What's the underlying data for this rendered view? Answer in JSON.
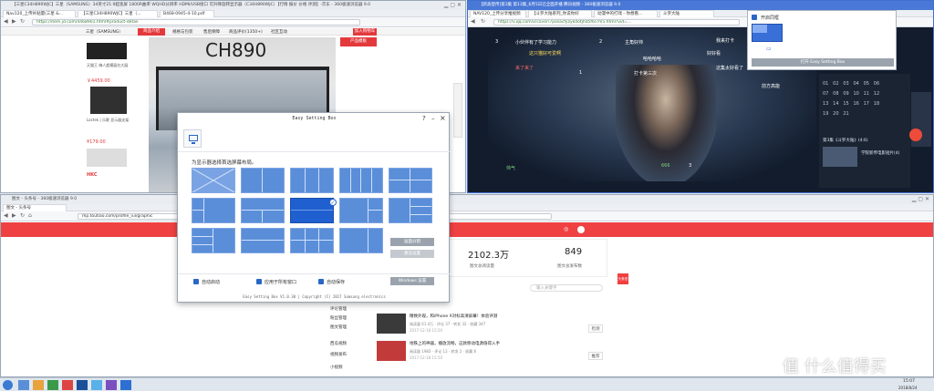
{
  "jd_window": {
    "title": "【三星C34H890WJC】三星（SAMSUNG）34英寸21:9超宽屏 1800R曲率 WQHD分辨率 HDMI/USB接口 可升降旋转显示器（C34H890WJC）【行情 报价 价格 评测】-京东 - 360极速浏览器 9.0",
    "url": "https://item.jd.com/4468901.html#product-detail",
    "tab1": "Nav120_上传补贴量(三星 &...",
    "tab2": "【三星C34H890WJC】三星（...",
    "tab3": "B468-0945-4-10.pdf",
    "nav_left": "三星（SAMSUNG）",
    "nav_tabs": [
      "商品介绍",
      "规格与包装",
      "售后保障",
      "商品评价(1350+)",
      "社区互动"
    ],
    "product_heading": "CH890",
    "cart": "加入购物车",
    "reco_label": "产品模板",
    "side": [
      "天猫王 嗨人超模展台大展",
      "￥4459.00",
      "¥459.00",
      "Loctek | 乐歌 显示器支架",
      "¥179.00",
      "HKC"
    ]
  },
  "qq_window": {
    "title": "【新高登传]第3集 第13集_6月5日已全面开播 腾讯视频 - 360极速浏览器 9.0",
    "url": "https://v.qq.com/x/cover/7pseacfyzykdotjhd5f6l7m5.html?vid=...",
    "tabs": [
      "NAV120_上传分享推视频",
      "【斗罗大陆系列_你说你好",
      "动漫中的打戏 - 你想看...",
      "斗罗大陆"
    ],
    "danmaku": [
      "小伙伴有了学习能力",
      "这只猫好可爱啊",
      "我来打卡",
      "好好看",
      "主角好帅",
      "哈哈哈哈",
      "来了来了",
      "打卡第三次",
      "这集太好看了",
      "前方高能",
      "帅气",
      "666"
    ],
    "likes": [
      "3",
      "2",
      "1",
      "3"
    ],
    "numbers": [
      "01",
      "02",
      "03",
      "04",
      "05",
      "06",
      "07",
      "08",
      "09",
      "10",
      "11",
      "12",
      "13",
      "14",
      "15",
      "16",
      "17",
      "18",
      "19",
      "20",
      "21"
    ],
    "side_texts": [
      "第3集《斗罗大陆》(4:6)",
      "学院新传电影短片(4)"
    ],
    "popup_title": "开启同框",
    "popup_btn": "打开 Easy Setting Box"
  },
  "tt_window": {
    "title": "图文 - 头条号 - 360极速浏览器 9.0",
    "tab1": "图文 - 头条号",
    "url": "mp.toutiao.com/profile_v3/graphic",
    "stat1_val": "2102.3万",
    "stat1_label": "图文总阅读量",
    "stat2_val": "849",
    "stat2_label": "图文总发布数",
    "stat0_label": "阅读量",
    "search_ph": "输入关键字",
    "menu": [
      "评论管理",
      "粉丝管理",
      "图文管理",
      "西瓜视频",
      "视频发布",
      "小视频"
    ],
    "art1_title": "精致外观，和iPhone X对标高清屏幕！体验评测",
    "art1_meta": "阅读量 61.4万 · 评论 37 · 转发 32 · 收藏 347",
    "art2_title": "地铁上的神器，播放流畅，这款移动电源值得入手",
    "art2_meta": "阅读量 1983 · 评论 12 · 转发 2 · 收藏 8",
    "date": "2017-12-18 15:50",
    "side_btn": "头条官方",
    "side_btns": [
      "检测",
      "推荐",
      "修改",
      "删除"
    ]
  },
  "esb": {
    "title": "Easy Setting Box",
    "question": "?",
    "min": "–",
    "close": "×",
    "instruction": "为显示器选择首选屏幕布局。",
    "btn_div": "画面分割",
    "btn_reset": "重设设置",
    "chk1": "自动启动",
    "chk2": "应用于所有窗口",
    "chk3": "自动保存",
    "windows_btn": "Windows 设置",
    "footer": "Easy Setting Box V1.0.30 | Copyright (C) 2017 Samsung electronics"
  },
  "taskbar": {
    "time": "15:07",
    "date": "2018/8/24"
  },
  "watermark": "值 什么值得买",
  "colors": {
    "accent": "#f04142",
    "esb_blue": "#5b8ed8",
    "esb_sel": "#1f5fcf"
  }
}
